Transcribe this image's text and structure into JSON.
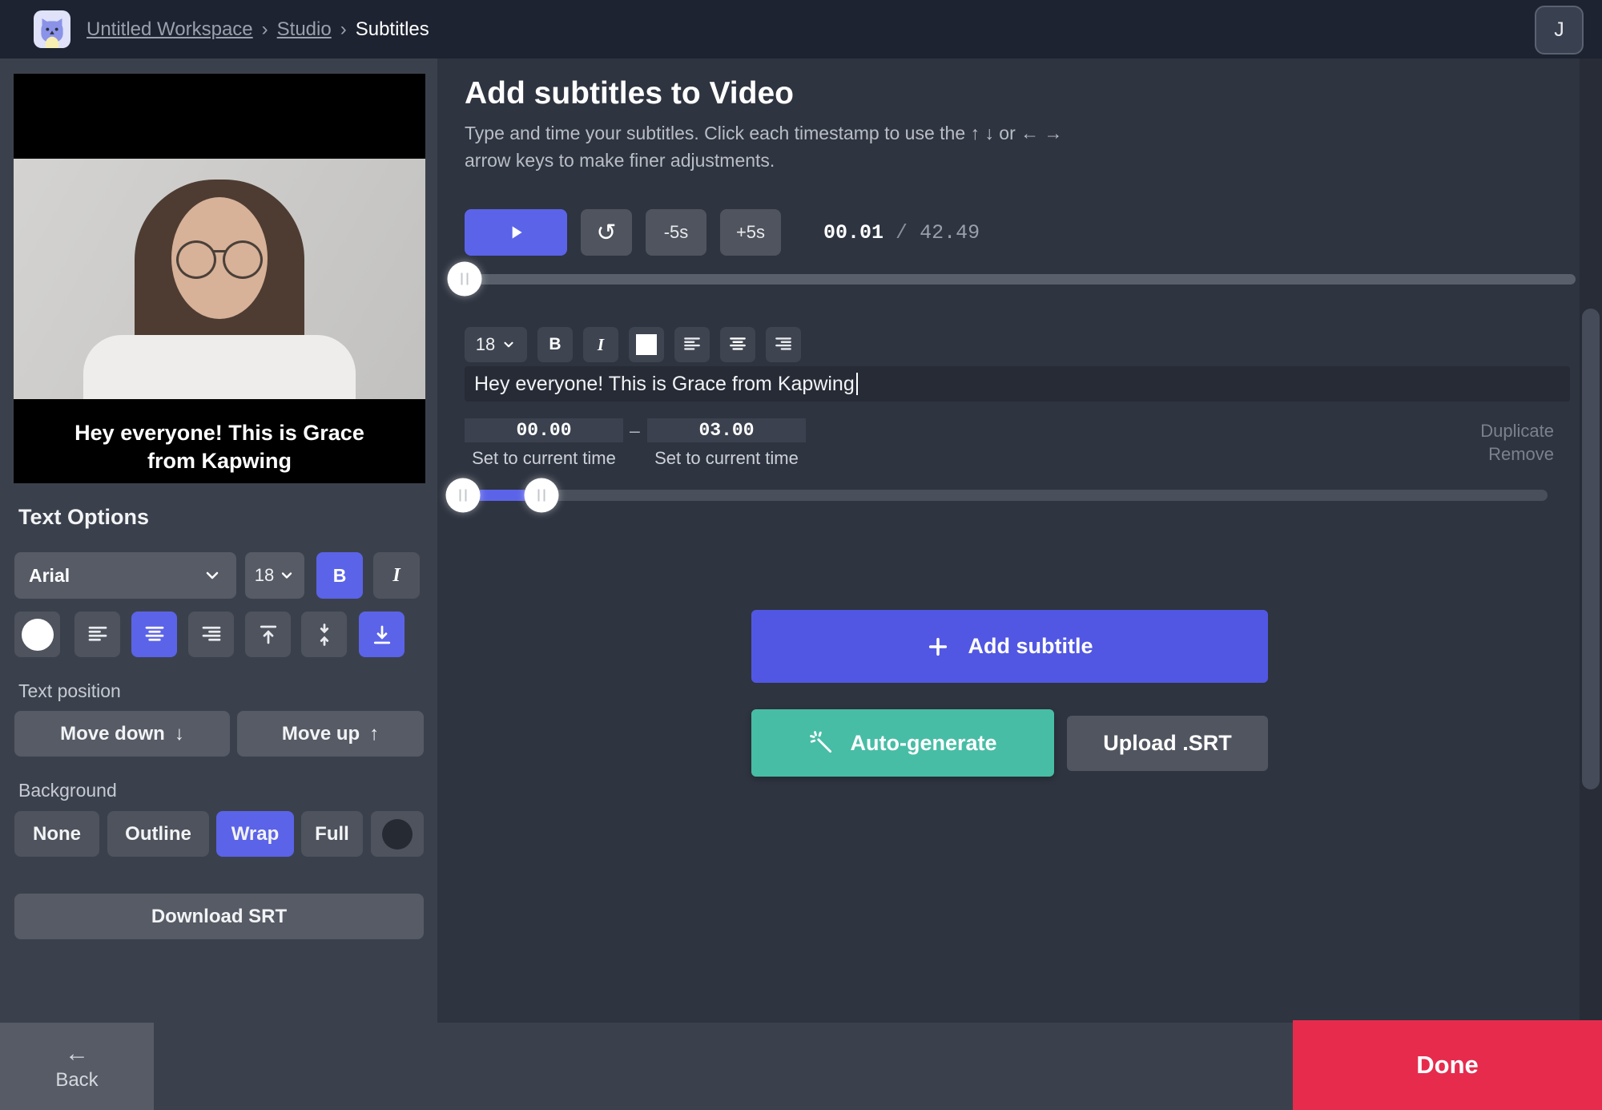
{
  "topbar": {
    "workspace": "Untitled Workspace",
    "separator": "›",
    "studio": "Studio",
    "current": "Subtitles",
    "avatar_initial": "J"
  },
  "preview": {
    "subtitle": "Hey everyone! This is Grace from Kapwing"
  },
  "sidebar": {
    "title": "Text Options",
    "font_family": "Arial",
    "font_size": "18",
    "bold": "B",
    "italic": "I",
    "text_position_label": "Text position",
    "move_down": "Move down",
    "move_up": "Move up",
    "background_label": "Background",
    "background_options": [
      "None",
      "Outline",
      "Wrap",
      "Full"
    ],
    "download_label": "Download SRT"
  },
  "main": {
    "title": "Add subtitles to Video",
    "desc_line1": "Type and time your subtitles. Click each timestamp to use the ↑ ↓ or ← →",
    "desc_line2": "arrow keys to make finer adjustments.",
    "controls": {
      "rewind": "-5s",
      "forward": "+5s",
      "current_time": "00.01",
      "time_separator": "/",
      "total_time": "42.49"
    },
    "editor": {
      "font_size": "18",
      "bold": "B",
      "italic": "I",
      "text": "Hey everyone! This is Grace from Kapwing",
      "start_time": "00.00",
      "dash": "–",
      "end_time": "03.00",
      "set_current_label": "Set to current time",
      "duplicate": "Duplicate",
      "remove": "Remove"
    },
    "add_subtitle": "Add subtitle",
    "auto_generate": "Auto-generate",
    "upload_srt": "Upload .SRT"
  },
  "footer": {
    "back": "Back",
    "done": "Done"
  },
  "icons": {
    "restart": "↺",
    "arrow_down": "↓",
    "arrow_up": "↑",
    "back_arrow": "←"
  },
  "colors": {
    "accent_blue": "#5b63e8",
    "add_subtitle_blue": "#5157e2",
    "auto_generate_teal": "#47bda5",
    "done_red": "#e62b4d",
    "topbar_bg": "#1d2330",
    "sidebar_bg": "#3b414c",
    "panel_bg": "#2e3440"
  }
}
